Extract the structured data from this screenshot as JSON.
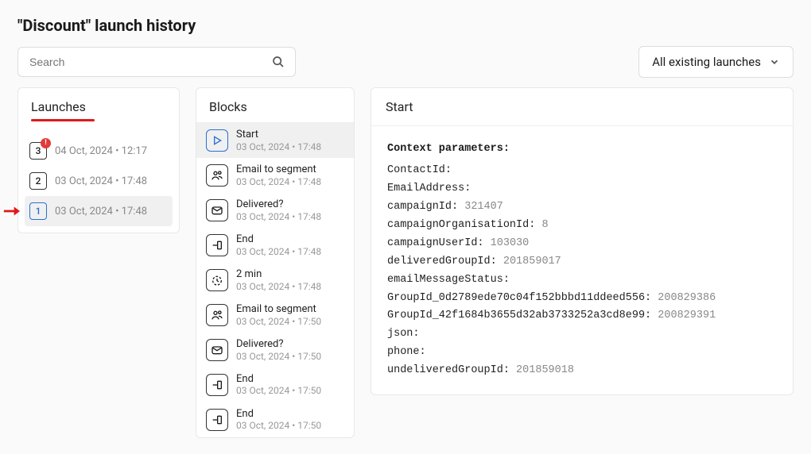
{
  "page_title": "\"Discount\" launch history",
  "search": {
    "placeholder": "Search"
  },
  "dropdown": {
    "label": "All existing launches"
  },
  "launches": {
    "title": "Launches",
    "items": [
      {
        "num": "3",
        "ts": "04 Oct, 2024 • 12:17",
        "alert": true
      },
      {
        "num": "2",
        "ts": "03 Oct, 2024 • 17:48"
      },
      {
        "num": "1",
        "ts": "03 Oct, 2024 • 17:48",
        "selected": true,
        "arrow": true
      }
    ]
  },
  "blocks": {
    "title": "Blocks",
    "items": [
      {
        "title": "Start",
        "ts": "03 Oct, 2024 • 17:48",
        "icon": "play",
        "selected": true
      },
      {
        "title": "Email to segment",
        "ts": "03 Oct, 2024 • 17:48",
        "icon": "users"
      },
      {
        "title": "Delivered?",
        "ts": "03 Oct, 2024 • 17:48",
        "icon": "mail"
      },
      {
        "title": "End",
        "ts": "03 Oct, 2024 • 17:48",
        "icon": "end"
      },
      {
        "title": "2 min",
        "ts": "03 Oct, 2024 • 17:48",
        "icon": "timer"
      },
      {
        "title": "Email to segment",
        "ts": "03 Oct, 2024 • 17:50",
        "icon": "users"
      },
      {
        "title": "Delivered?",
        "ts": "03 Oct, 2024 • 17:50",
        "icon": "mail"
      },
      {
        "title": "End",
        "ts": "03 Oct, 2024 • 17:50",
        "icon": "end"
      },
      {
        "title": "End",
        "ts": "03 Oct, 2024 • 17:50",
        "icon": "end"
      }
    ]
  },
  "detail": {
    "title": "Start",
    "params_heading": "Context parameters:",
    "params": [
      {
        "k": "ContactId:",
        "v": ""
      },
      {
        "k": "EmailAddress:",
        "v": ""
      },
      {
        "k": "campaignId:",
        "v": "321407"
      },
      {
        "k": "campaignOrganisationId:",
        "v": "8"
      },
      {
        "k": "campaignUserId:",
        "v": "103030"
      },
      {
        "k": "deliveredGroupId:",
        "v": "201859017"
      },
      {
        "k": "emailMessageStatus:",
        "v": ""
      },
      {
        "k": "GroupId_0d2789ede70c04f152bbbd11ddeed556:",
        "v": "200829386"
      },
      {
        "k": "GroupId_42f1684b3655d32ab3733252a3cd8e99:",
        "v": "200829391"
      },
      {
        "k": "json:",
        "v": ""
      },
      {
        "k": "phone:",
        "v": ""
      },
      {
        "k": "undeliveredGroupId:",
        "v": "201859018"
      }
    ]
  },
  "icons": {
    "alert_glyph": "!"
  }
}
